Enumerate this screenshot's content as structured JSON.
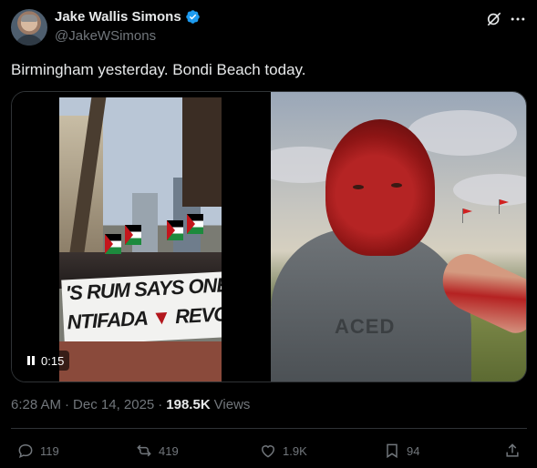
{
  "author": {
    "display_name": "Jake Wallis Simons",
    "handle": "@JakeWSimons",
    "verified": true,
    "avatar_icon": "avatar"
  },
  "header_icons": [
    "grok-icon",
    "more-icon"
  ],
  "tweet": {
    "text": "Birmingham yesterday. Bondi Beach today."
  },
  "media": {
    "video": {
      "timer": "0:15",
      "banner_line1": "'S RUM SAYS ONE SOL",
      "banner_line2a": "NTIFADA",
      "banner_line2b": "REVOL"
    },
    "photo": {
      "shirt_text": "ACED"
    }
  },
  "meta": {
    "time": "6:28 AM",
    "separator": "·",
    "date": "Dec 14, 2025",
    "views_count": "198.5K",
    "views_label": "Views"
  },
  "actions": {
    "replies": "119",
    "reposts": "419",
    "likes": "1.9K",
    "bookmarks": "94"
  },
  "colors": {
    "background": "#000000",
    "text_primary": "#e7e9ea",
    "text_secondary": "#71767b",
    "verified_blue": "#1d9bf0",
    "border": "#2f3336"
  }
}
